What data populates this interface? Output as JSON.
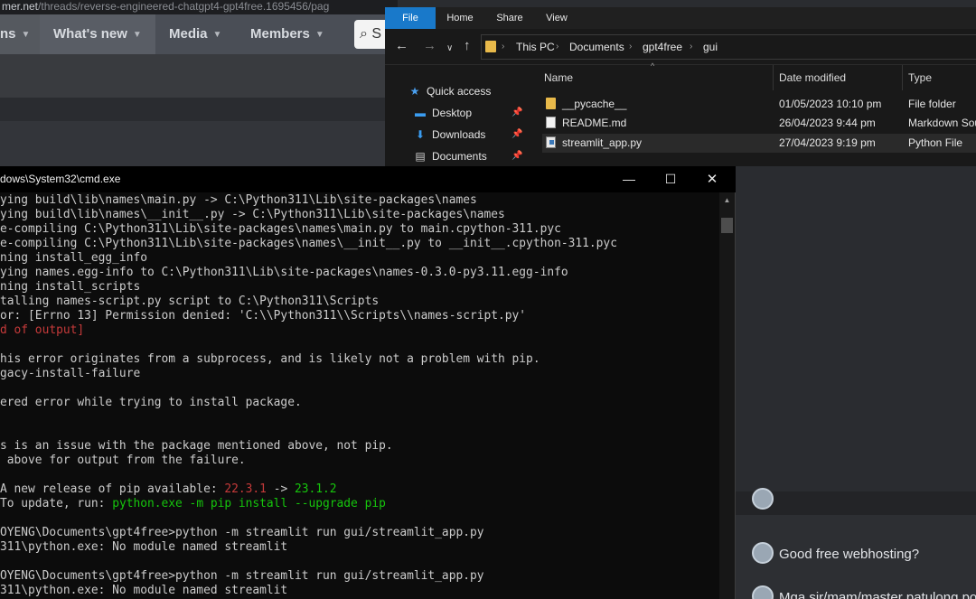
{
  "browser": {
    "url_host": "mer.net",
    "url_path": "/threads/reverse-engineered-chatgpt4-gpt4free.1695456/pag",
    "nav": {
      "first_label": "ns",
      "whats_new_label": "What's new",
      "media_label": "Media",
      "members_label": "Members",
      "caret": "▼",
      "search_glyph": "⌕",
      "search_text": "S"
    },
    "forum": {
      "items": [
        {
          "title": "Good free webhosting?"
        },
        {
          "title": "Mga sir/mam/master patulong po"
        }
      ]
    }
  },
  "explorer": {
    "ribbon": {
      "file": "File",
      "home": "Home",
      "share": "Share",
      "view": "View"
    },
    "nav_buttons": {
      "back": "←",
      "forward": "→",
      "recent": "∨",
      "up": "↑"
    },
    "breadcrumb": [
      "This PC",
      "Documents",
      "gpt4free",
      "gui"
    ],
    "crumb_sep": "›",
    "sidebar": [
      {
        "label": "Quick access",
        "icon": "star-icon",
        "glyph": "★",
        "color": "#4aa0f0",
        "pinned": false
      },
      {
        "label": "Desktop",
        "icon": "desktop-icon",
        "glyph": "▬",
        "color": "#3a9cf0",
        "pinned": true
      },
      {
        "label": "Downloads",
        "icon": "download-icon",
        "glyph": "⬇",
        "color": "#3a9cf0",
        "pinned": true
      },
      {
        "label": "Documents",
        "icon": "documents-icon",
        "glyph": "▤",
        "color": "#cfcfcf",
        "pinned": true
      }
    ],
    "pin_glyph": "📌",
    "columns": {
      "name": "Name",
      "date": "Date modified",
      "type": "Type"
    },
    "sort_caret": "^",
    "files": [
      {
        "name": "__pycache__",
        "date": "01/05/2023 10:10 pm",
        "type": "File folder",
        "icon": "folder-icon",
        "selected": false
      },
      {
        "name": "README.md",
        "date": "26/04/2023 9:44 pm",
        "type": "Markdown Sou",
        "icon": "document-icon",
        "selected": false
      },
      {
        "name": "streamlit_app.py",
        "date": "27/04/2023 9:19 pm",
        "type": "Python File",
        "icon": "python-file-icon",
        "selected": true
      }
    ]
  },
  "cmd": {
    "title": "dows\\System32\\cmd.exe",
    "buttons": {
      "minimize": "—",
      "maximize": "☐",
      "close": "✕"
    },
    "lines": [
      {
        "segments": [
          {
            "text": "ying build\\lib\\names\\main.py -> C:\\Python311\\Lib\\site-packages\\names",
            "color": "default"
          }
        ]
      },
      {
        "segments": [
          {
            "text": "ying build\\lib\\names\\__init__.py -> C:\\Python311\\Lib\\site-packages\\names",
            "color": "default"
          }
        ]
      },
      {
        "segments": [
          {
            "text": "e-compiling C:\\Python311\\Lib\\site-packages\\names\\main.py to main.cpython-311.pyc",
            "color": "default"
          }
        ]
      },
      {
        "segments": [
          {
            "text": "e-compiling C:\\Python311\\Lib\\site-packages\\names\\__init__.py to __init__.cpython-311.pyc",
            "color": "default"
          }
        ]
      },
      {
        "segments": [
          {
            "text": "ning install_egg_info",
            "color": "default"
          }
        ]
      },
      {
        "segments": [
          {
            "text": "ying names.egg-info to C:\\Python311\\Lib\\site-packages\\names-0.3.0-py3.11.egg-info",
            "color": "default"
          }
        ]
      },
      {
        "segments": [
          {
            "text": "ning install_scripts",
            "color": "default"
          }
        ]
      },
      {
        "segments": [
          {
            "text": "talling names-script.py script to C:\\Python311\\Scripts",
            "color": "default"
          }
        ]
      },
      {
        "segments": [
          {
            "text": "or: [Errno 13] Permission denied: 'C:\\\\Python311\\\\Scripts\\\\names-script.py'",
            "color": "default"
          }
        ]
      },
      {
        "segments": [
          {
            "text": "d of output]",
            "color": "red"
          }
        ]
      },
      {
        "segments": [
          {
            "text": "",
            "color": "default"
          }
        ]
      },
      {
        "segments": [
          {
            "text": "his error originates from a subprocess, and is likely not a problem with pip.",
            "color": "default"
          }
        ]
      },
      {
        "segments": [
          {
            "text": "gacy-install-failure",
            "color": "default"
          }
        ]
      },
      {
        "segments": [
          {
            "text": "",
            "color": "default"
          }
        ]
      },
      {
        "segments": [
          {
            "text": "ered error while trying to install package.",
            "color": "default"
          }
        ]
      },
      {
        "segments": [
          {
            "text": "",
            "color": "default"
          }
        ]
      },
      {
        "segments": [
          {
            "text": "",
            "color": "default"
          }
        ]
      },
      {
        "segments": [
          {
            "text": "s is an issue with the package mentioned above, not pip.",
            "color": "default"
          }
        ]
      },
      {
        "segments": [
          {
            "text": " above for output from the failure.",
            "color": "default"
          }
        ]
      },
      {
        "segments": [
          {
            "text": "",
            "color": "default"
          }
        ]
      },
      {
        "segments": [
          {
            "text": "A new release of pip available: ",
            "color": "default"
          },
          {
            "text": "22.3.1",
            "color": "red"
          },
          {
            "text": " -> ",
            "color": "default"
          },
          {
            "text": "23.1.2",
            "color": "green"
          }
        ]
      },
      {
        "segments": [
          {
            "text": "To update, run: ",
            "color": "default"
          },
          {
            "text": "python.exe -m pip install --upgrade pip",
            "color": "green"
          }
        ]
      },
      {
        "segments": [
          {
            "text": "",
            "color": "default"
          }
        ]
      },
      {
        "segments": [
          {
            "text": "OYENG\\Documents\\gpt4free>python -m streamlit run gui/streamlit_app.py",
            "color": "default"
          }
        ]
      },
      {
        "segments": [
          {
            "text": "311\\python.exe: No module named streamlit",
            "color": "default"
          }
        ]
      },
      {
        "segments": [
          {
            "text": "",
            "color": "default"
          }
        ]
      },
      {
        "segments": [
          {
            "text": "OYENG\\Documents\\gpt4free>python -m streamlit run gui/streamlit_app.py",
            "color": "default"
          }
        ]
      },
      {
        "segments": [
          {
            "text": "311\\python.exe: No module named streamlit",
            "color": "default"
          }
        ]
      }
    ],
    "scroll": {
      "up": "▲",
      "down": "▼"
    }
  }
}
